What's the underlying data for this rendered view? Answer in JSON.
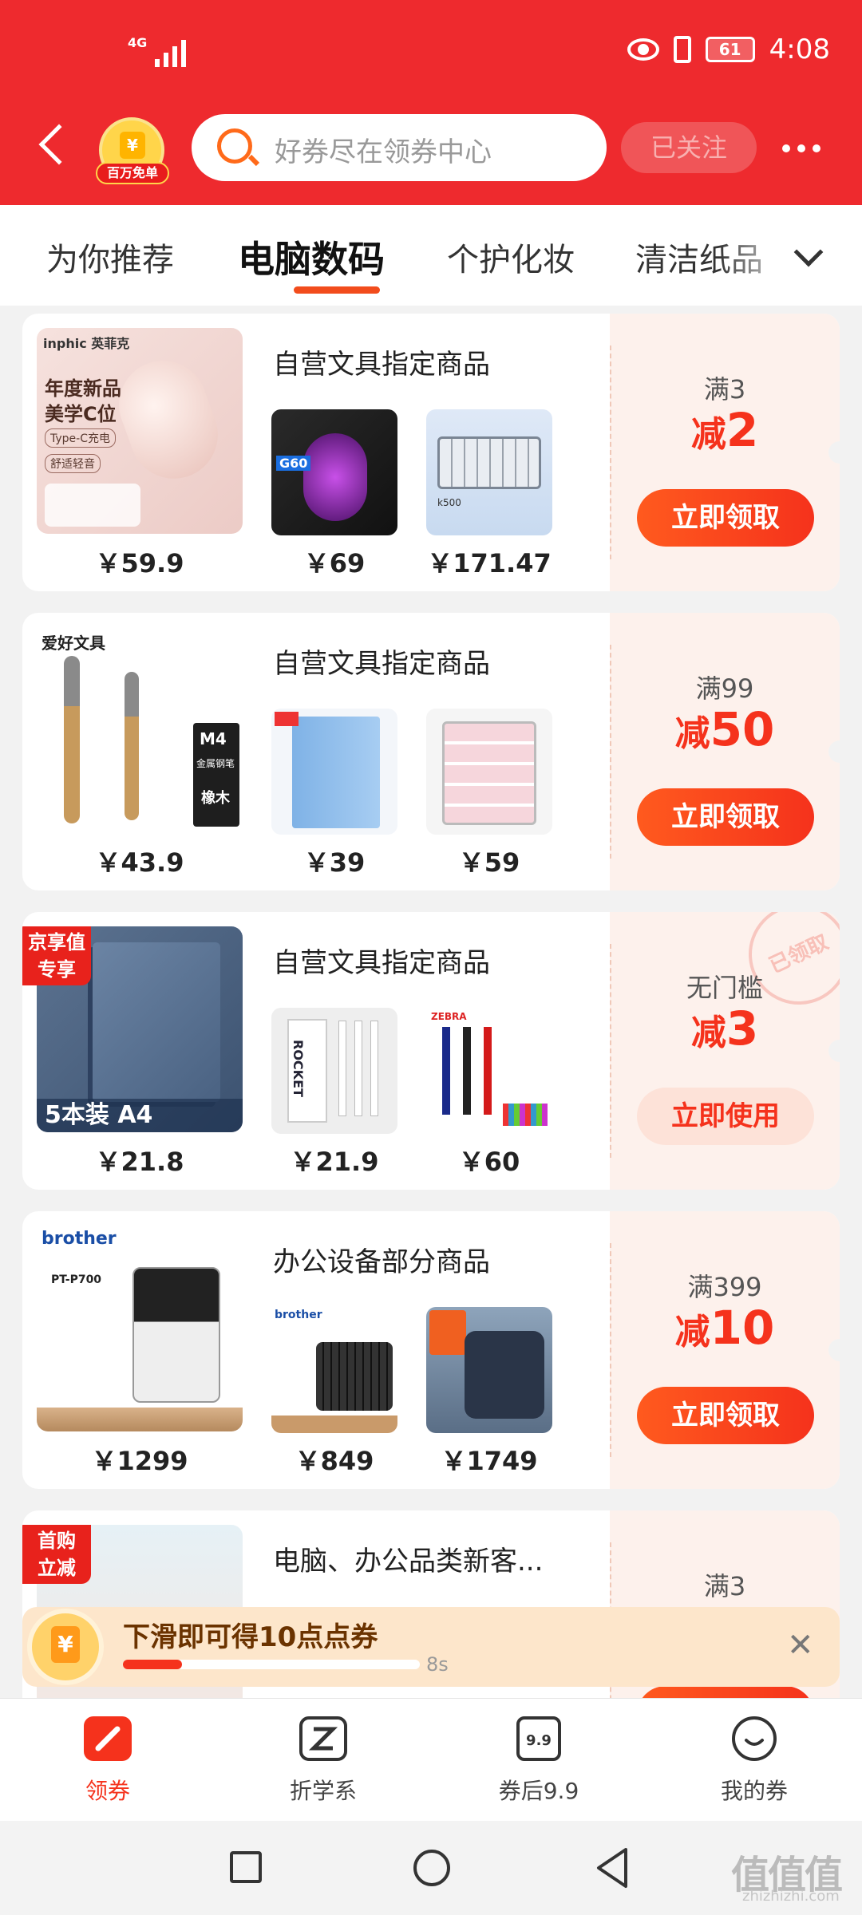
{
  "status_bar": {
    "network": "4G",
    "battery": "61",
    "time": "4:08"
  },
  "header": {
    "logo_text": "百万免单",
    "search_placeholder": "好券尽在领券中心",
    "follow_label": "已关注"
  },
  "tabs": [
    "为你推荐",
    "电脑数码",
    "个护化妆",
    "清洁纸品"
  ],
  "active_tab": 1,
  "cards": [
    {
      "title": "自营文具指定商品",
      "prices": [
        "￥59.9",
        "￥69",
        "￥171.47"
      ],
      "condition": "满3",
      "discount_prefix": "减",
      "discount_value": "2",
      "button": "立即领取",
      "main_brand": "inphic 英菲克",
      "main_text": [
        "年度新品",
        "美学C位",
        "Type-C充电",
        "舒适轻音"
      ],
      "thumb_labels": [
        "G60",
        "k500"
      ]
    },
    {
      "title": "自营文具指定商品",
      "prices": [
        "￥43.9",
        "￥39",
        "￥59"
      ],
      "condition": "满99",
      "discount_prefix": "减",
      "discount_value": "50",
      "button": "立即领取",
      "main_brand": "爱好文具",
      "main_text": [
        "M4",
        "金属钢笔",
        "橡木"
      ]
    },
    {
      "title": "自营文具指定商品",
      "prices": [
        "￥21.8",
        "￥21.9",
        "￥60"
      ],
      "condition": "无门槛",
      "discount_prefix": "减",
      "discount_value": "3",
      "button": "立即使用",
      "tag": [
        "京享值",
        "专享"
      ],
      "stamp": "已领取",
      "main_text": [
        "5本装 A4"
      ],
      "thumb_labels": [
        "ROCKET",
        "ZEBRA"
      ]
    },
    {
      "title": "办公设备部分商品",
      "prices": [
        "￥1299",
        "￥849",
        "￥1749"
      ],
      "condition": "满399",
      "discount_prefix": "减",
      "discount_value": "10",
      "button": "立即领取",
      "main_brand": "brother",
      "main_text": [
        "PT-P700"
      ],
      "thumb_labels": [
        "brother"
      ]
    },
    {
      "title": "电脑、办公品类新客...",
      "prices": [],
      "condition": "满3",
      "tag": [
        "首购",
        "立减"
      ]
    }
  ],
  "banner": {
    "text": "下滑即可得10点点券",
    "countdown": "8s",
    "progress": 0.2
  },
  "bottom_nav": [
    {
      "label": "领券"
    },
    {
      "label": "折学系"
    },
    {
      "label": "券后9.9",
      "icon_text": "9.9"
    },
    {
      "label": "我的券"
    }
  ],
  "watermark": {
    "text": "值值值",
    "sub": "zhizhizhi.com"
  },
  "colors": {
    "brand_red": "#ee2a2e",
    "accent": "#f5321c"
  }
}
